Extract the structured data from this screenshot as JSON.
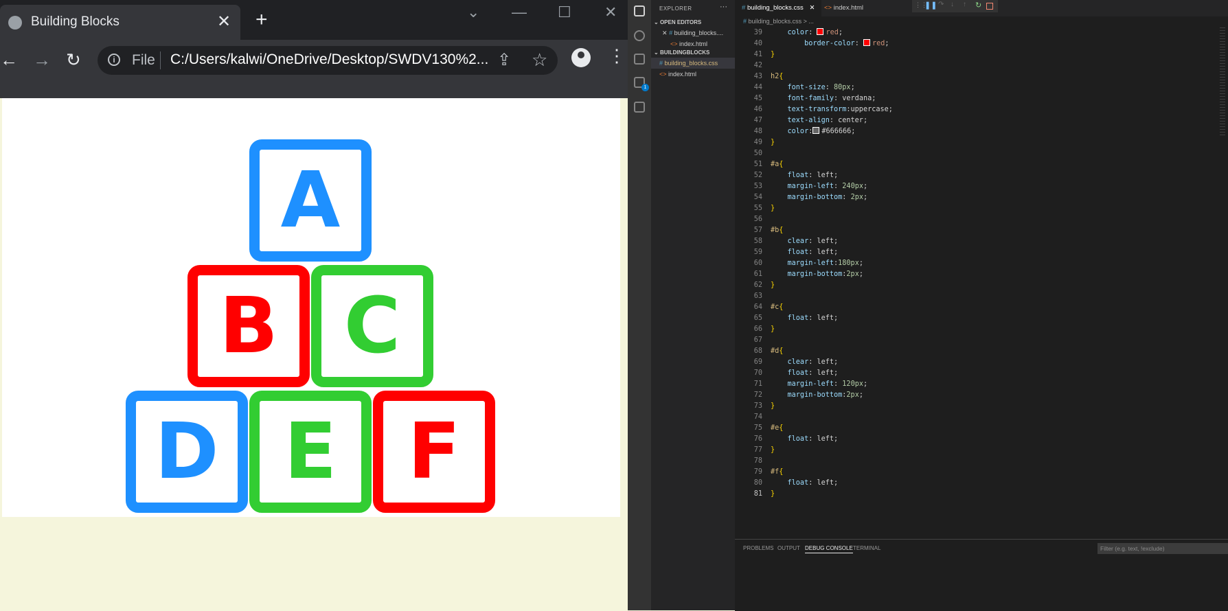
{
  "browser": {
    "tab_title": "Building Blocks",
    "tab_close": "✕",
    "new_tab": "+",
    "file_label": "File",
    "url": "C:/Users/kalwi/OneDrive/Desktop/SWDV130%2...",
    "blocks": [
      {
        "letter": "A",
        "color": "#1e90ff"
      },
      {
        "letter": "B",
        "color": "#ff0000"
      },
      {
        "letter": "C",
        "color": "#32cd32"
      },
      {
        "letter": "D",
        "color": "#1e90ff"
      },
      {
        "letter": "E",
        "color": "#32cd32"
      },
      {
        "letter": "F",
        "color": "#ff0000"
      }
    ]
  },
  "vscode": {
    "explorer_label": "EXPLORER",
    "explorer_more": "···",
    "open_editors_label": "OPEN EDITORS",
    "open_editors": [
      {
        "name": "building_blocks....",
        "icon": "#"
      },
      {
        "name": "index.html",
        "icon": "<>"
      }
    ],
    "folder_label": "BUILDINGBLOCKS",
    "files": [
      {
        "name": "building_blocks.css",
        "icon": "#"
      },
      {
        "name": "index.html",
        "icon": "<>"
      }
    ],
    "tabs": [
      {
        "name": "building_blocks.css",
        "icon": "#"
      },
      {
        "name": "index.html",
        "icon": "<>"
      }
    ],
    "breadcrumb": "building_blocks.css > ...",
    "debug_badge": "1",
    "code_lines": [
      {
        "n": 39,
        "parts": [
          [
            "prop",
            "    color"
          ],
          [
            "plain",
            ": "
          ],
          [
            "sw",
            "#ff0000"
          ],
          [
            "val",
            "red"
          ],
          [
            "plain",
            ";"
          ]
        ]
      },
      {
        "n": 40,
        "parts": [
          [
            "plain",
            "        "
          ],
          [
            "prop",
            "border-color"
          ],
          [
            "plain",
            ": "
          ],
          [
            "sw",
            "#ff0000"
          ],
          [
            "val",
            "red"
          ],
          [
            "plain",
            ";"
          ]
        ]
      },
      {
        "n": 41,
        "parts": [
          [
            "br",
            "}"
          ]
        ]
      },
      {
        "n": 42,
        "parts": []
      },
      {
        "n": 43,
        "parts": [
          [
            "sel",
            "h2"
          ],
          [
            "br",
            "{"
          ]
        ]
      },
      {
        "n": 44,
        "parts": [
          [
            "prop",
            "    font-size"
          ],
          [
            "plain",
            ": "
          ],
          [
            "numv",
            "80px"
          ],
          [
            "plain",
            ";"
          ]
        ]
      },
      {
        "n": 45,
        "parts": [
          [
            "prop",
            "    font-family"
          ],
          [
            "plain",
            ": verdana;"
          ]
        ]
      },
      {
        "n": 46,
        "parts": [
          [
            "prop",
            "    text-transform"
          ],
          [
            "plain",
            ":uppercase;"
          ]
        ]
      },
      {
        "n": 47,
        "parts": [
          [
            "prop",
            "    text-align"
          ],
          [
            "plain",
            ": center;"
          ]
        ]
      },
      {
        "n": 48,
        "parts": [
          [
            "prop",
            "    color"
          ],
          [
            "plain",
            ":"
          ],
          [
            "sw",
            "#666666"
          ],
          [
            "plain",
            "#666666;"
          ]
        ]
      },
      {
        "n": 49,
        "parts": [
          [
            "br",
            "}"
          ]
        ]
      },
      {
        "n": 50,
        "parts": []
      },
      {
        "n": 51,
        "parts": [
          [
            "sel",
            "#a"
          ],
          [
            "br",
            "{"
          ]
        ]
      },
      {
        "n": 52,
        "parts": [
          [
            "prop",
            "    float"
          ],
          [
            "plain",
            ": left;"
          ]
        ]
      },
      {
        "n": 53,
        "parts": [
          [
            "prop",
            "    margin-left"
          ],
          [
            "plain",
            ": "
          ],
          [
            "numv",
            "240px"
          ],
          [
            "plain",
            ";"
          ]
        ]
      },
      {
        "n": 54,
        "parts": [
          [
            "prop",
            "    margin-bottom"
          ],
          [
            "plain",
            ": "
          ],
          [
            "numv",
            "2px"
          ],
          [
            "plain",
            ";"
          ]
        ]
      },
      {
        "n": 55,
        "parts": [
          [
            "br",
            "}"
          ]
        ]
      },
      {
        "n": 56,
        "parts": []
      },
      {
        "n": 57,
        "parts": [
          [
            "sel",
            "#b"
          ],
          [
            "br",
            "{"
          ]
        ]
      },
      {
        "n": 58,
        "parts": [
          [
            "prop",
            "    clear"
          ],
          [
            "plain",
            ": left;"
          ]
        ]
      },
      {
        "n": 59,
        "parts": [
          [
            "prop",
            "    float"
          ],
          [
            "plain",
            ": left;"
          ]
        ]
      },
      {
        "n": 60,
        "parts": [
          [
            "prop",
            "    margin-left"
          ],
          [
            "plain",
            ":"
          ],
          [
            "numv",
            "180px"
          ],
          [
            "plain",
            ";"
          ]
        ]
      },
      {
        "n": 61,
        "parts": [
          [
            "prop",
            "    margin-bottom"
          ],
          [
            "plain",
            ":"
          ],
          [
            "numv",
            "2px"
          ],
          [
            "plain",
            ";"
          ]
        ]
      },
      {
        "n": 62,
        "parts": [
          [
            "br",
            "}"
          ]
        ]
      },
      {
        "n": 63,
        "parts": []
      },
      {
        "n": 64,
        "parts": [
          [
            "sel",
            "#c"
          ],
          [
            "br",
            "{"
          ]
        ]
      },
      {
        "n": 65,
        "parts": [
          [
            "prop",
            "    float"
          ],
          [
            "plain",
            ": left;"
          ]
        ]
      },
      {
        "n": 66,
        "parts": [
          [
            "br",
            "}"
          ]
        ]
      },
      {
        "n": 67,
        "parts": []
      },
      {
        "n": 68,
        "parts": [
          [
            "sel",
            "#d"
          ],
          [
            "br",
            "{"
          ]
        ]
      },
      {
        "n": 69,
        "parts": [
          [
            "prop",
            "    clear"
          ],
          [
            "plain",
            ": left;"
          ]
        ]
      },
      {
        "n": 70,
        "parts": [
          [
            "prop",
            "    float"
          ],
          [
            "plain",
            ": left;"
          ]
        ]
      },
      {
        "n": 71,
        "parts": [
          [
            "prop",
            "    margin-left"
          ],
          [
            "plain",
            ": "
          ],
          [
            "numv",
            "120px"
          ],
          [
            "plain",
            ";"
          ]
        ]
      },
      {
        "n": 72,
        "parts": [
          [
            "prop",
            "    margin-bottom"
          ],
          [
            "plain",
            ":"
          ],
          [
            "numv",
            "2px"
          ],
          [
            "plain",
            ";"
          ]
        ]
      },
      {
        "n": 73,
        "parts": [
          [
            "br",
            "}"
          ]
        ]
      },
      {
        "n": 74,
        "parts": []
      },
      {
        "n": 75,
        "parts": [
          [
            "sel",
            "#e"
          ],
          [
            "br",
            "{"
          ]
        ]
      },
      {
        "n": 76,
        "parts": [
          [
            "prop",
            "    float"
          ],
          [
            "plain",
            ": left;"
          ]
        ]
      },
      {
        "n": 77,
        "parts": [
          [
            "br",
            "}"
          ]
        ]
      },
      {
        "n": 78,
        "parts": []
      },
      {
        "n": 79,
        "parts": [
          [
            "sel",
            "#f"
          ],
          [
            "br",
            "{"
          ]
        ]
      },
      {
        "n": 80,
        "parts": [
          [
            "prop",
            "    float"
          ],
          [
            "plain",
            ": left;"
          ]
        ]
      },
      {
        "n": 81,
        "parts": [
          [
            "br",
            "}"
          ]
        ]
      }
    ],
    "current_line": 81,
    "panel_tabs": [
      "PROBLEMS",
      "OUTPUT",
      "DEBUG CONSOLE",
      "TERMINAL"
    ],
    "active_panel_tab": "DEBUG CONSOLE",
    "filter_placeholder": "Filter (e.g. text, !exclude)"
  }
}
